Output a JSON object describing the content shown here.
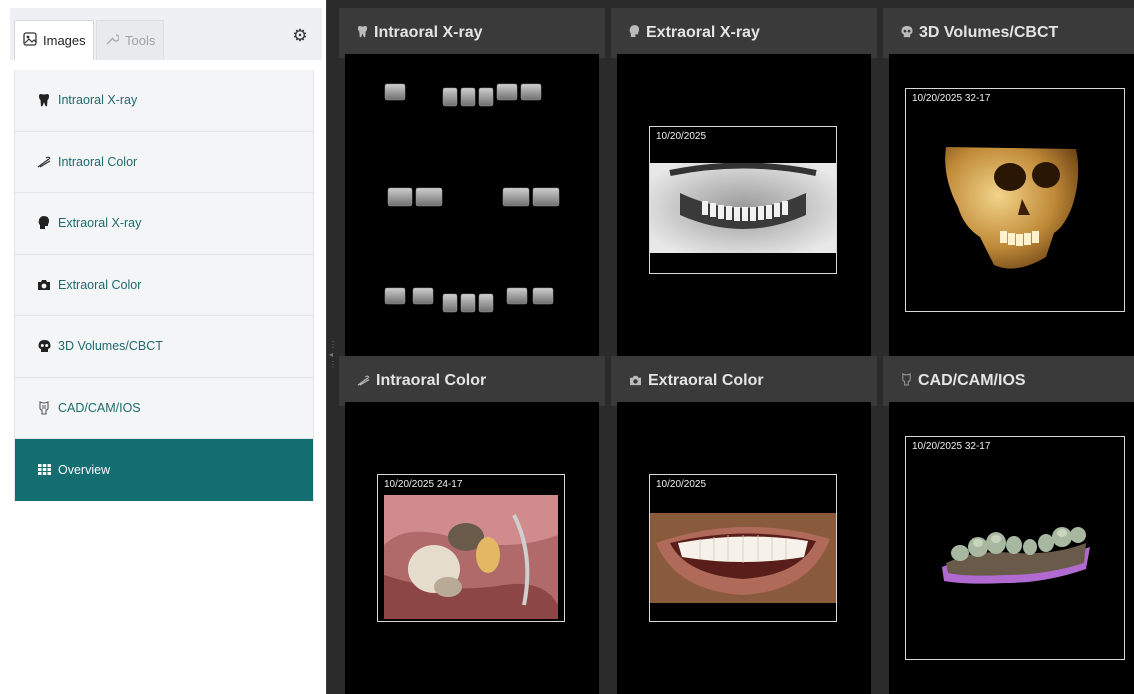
{
  "sidebar": {
    "tabs": [
      {
        "label": "Images",
        "icon": "image-icon"
      },
      {
        "label": "Tools",
        "icon": "wrench-icon"
      }
    ],
    "settings_icon": "gear-icon",
    "items": [
      {
        "label": "Intraoral X-ray",
        "icon": "tooth-icon"
      },
      {
        "label": "Intraoral Color",
        "icon": "intraoral-camera-icon"
      },
      {
        "label": "Extraoral X-ray",
        "icon": "head-profile-icon"
      },
      {
        "label": "Extraoral Color",
        "icon": "camera-icon"
      },
      {
        "label": "3D Volumes/CBCT",
        "icon": "skull-icon"
      },
      {
        "label": "CAD/CAM/IOS",
        "icon": "crown-icon"
      },
      {
        "label": "Overview",
        "icon": "grid-icon",
        "active": true
      }
    ]
  },
  "tiles": [
    {
      "title": "Intraoral X-ray",
      "icon": "tooth-icon",
      "date": ""
    },
    {
      "title": "Extraoral X-ray",
      "icon": "head-profile-icon",
      "date": "10/20/2025"
    },
    {
      "title": "3D Volumes/CBCT",
      "icon": "skull-icon",
      "date": "10/20/2025  32-17"
    },
    {
      "title": "Intraoral Color",
      "icon": "intraoral-camera-icon",
      "date": "10/20/2025  24-17"
    },
    {
      "title": "Extraoral Color",
      "icon": "camera-icon",
      "date": "10/20/2025"
    },
    {
      "title": "CAD/CAM/IOS",
      "icon": "crown-icon",
      "date": "10/20/2025  32-17"
    }
  ],
  "colors": {
    "accent": "#136d71",
    "nav_text": "#1e6a6e",
    "viewer_bg": "#2b2b2b",
    "tile_header": "#3a3a3a"
  }
}
